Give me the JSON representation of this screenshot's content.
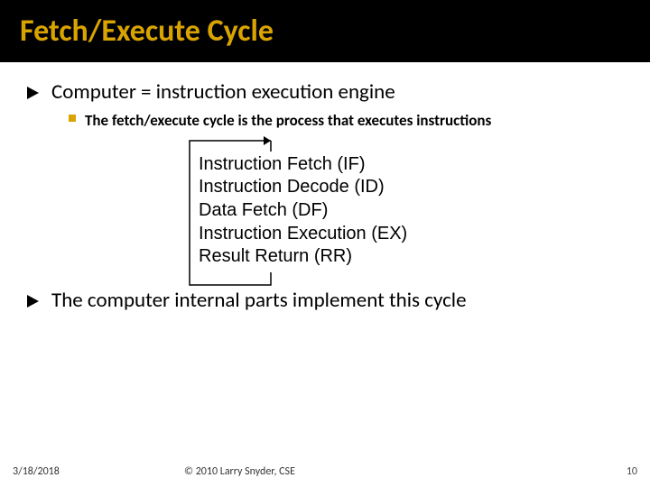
{
  "title": "Fetch/Execute Cycle",
  "bullets": {
    "b0": "Computer = instruction execution engine",
    "sub0": "The fetch/execute cycle is the process that executes instructions",
    "b1": "The computer internal parts implement this cycle"
  },
  "cycle": {
    "s0": "Instruction Fetch (IF)",
    "s1": "Instruction Decode (ID)",
    "s2": "Data Fetch (DF)",
    "s3": "Instruction Execution (EX)",
    "s4": "Result Return (RR)"
  },
  "footer": {
    "date": "3/18/2018",
    "copyright": "© 2010 Larry Snyder, CSE",
    "page": "10"
  }
}
